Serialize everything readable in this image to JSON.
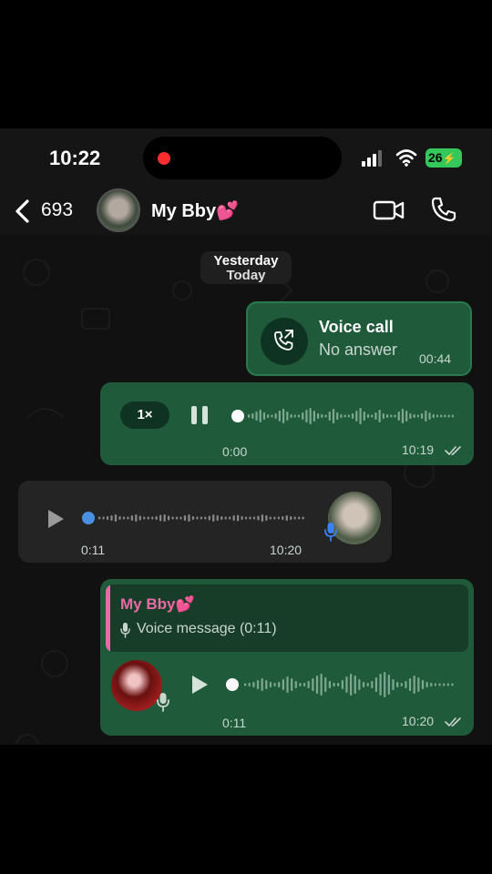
{
  "status_bar": {
    "time": "10:22",
    "battery": "26"
  },
  "header": {
    "back_count": "693",
    "contact_name": "My Bby💕"
  },
  "date_chip": {
    "line1": "Yesterday",
    "line2": "Today"
  },
  "messages": {
    "call": {
      "title": "Voice call",
      "subtitle": "No answer",
      "time": "00:44"
    },
    "voice_out_1": {
      "speed": "1×",
      "elapsed": "0:00",
      "time": "10:19"
    },
    "voice_in_1": {
      "duration": "0:11",
      "time": "10:20"
    },
    "voice_out_2": {
      "reply_name": "My Bby💕",
      "reply_text": "Voice message (0:11)",
      "duration": "0:11",
      "time": "10:20"
    }
  },
  "colors": {
    "outgoing_bubble": "#1f5a3a",
    "incoming_bubble": "#242424",
    "accent_pink": "#e86aa7",
    "recording_red": "#ff2d2d",
    "battery_green": "#34c759",
    "mic_blue": "#3b82f6"
  }
}
